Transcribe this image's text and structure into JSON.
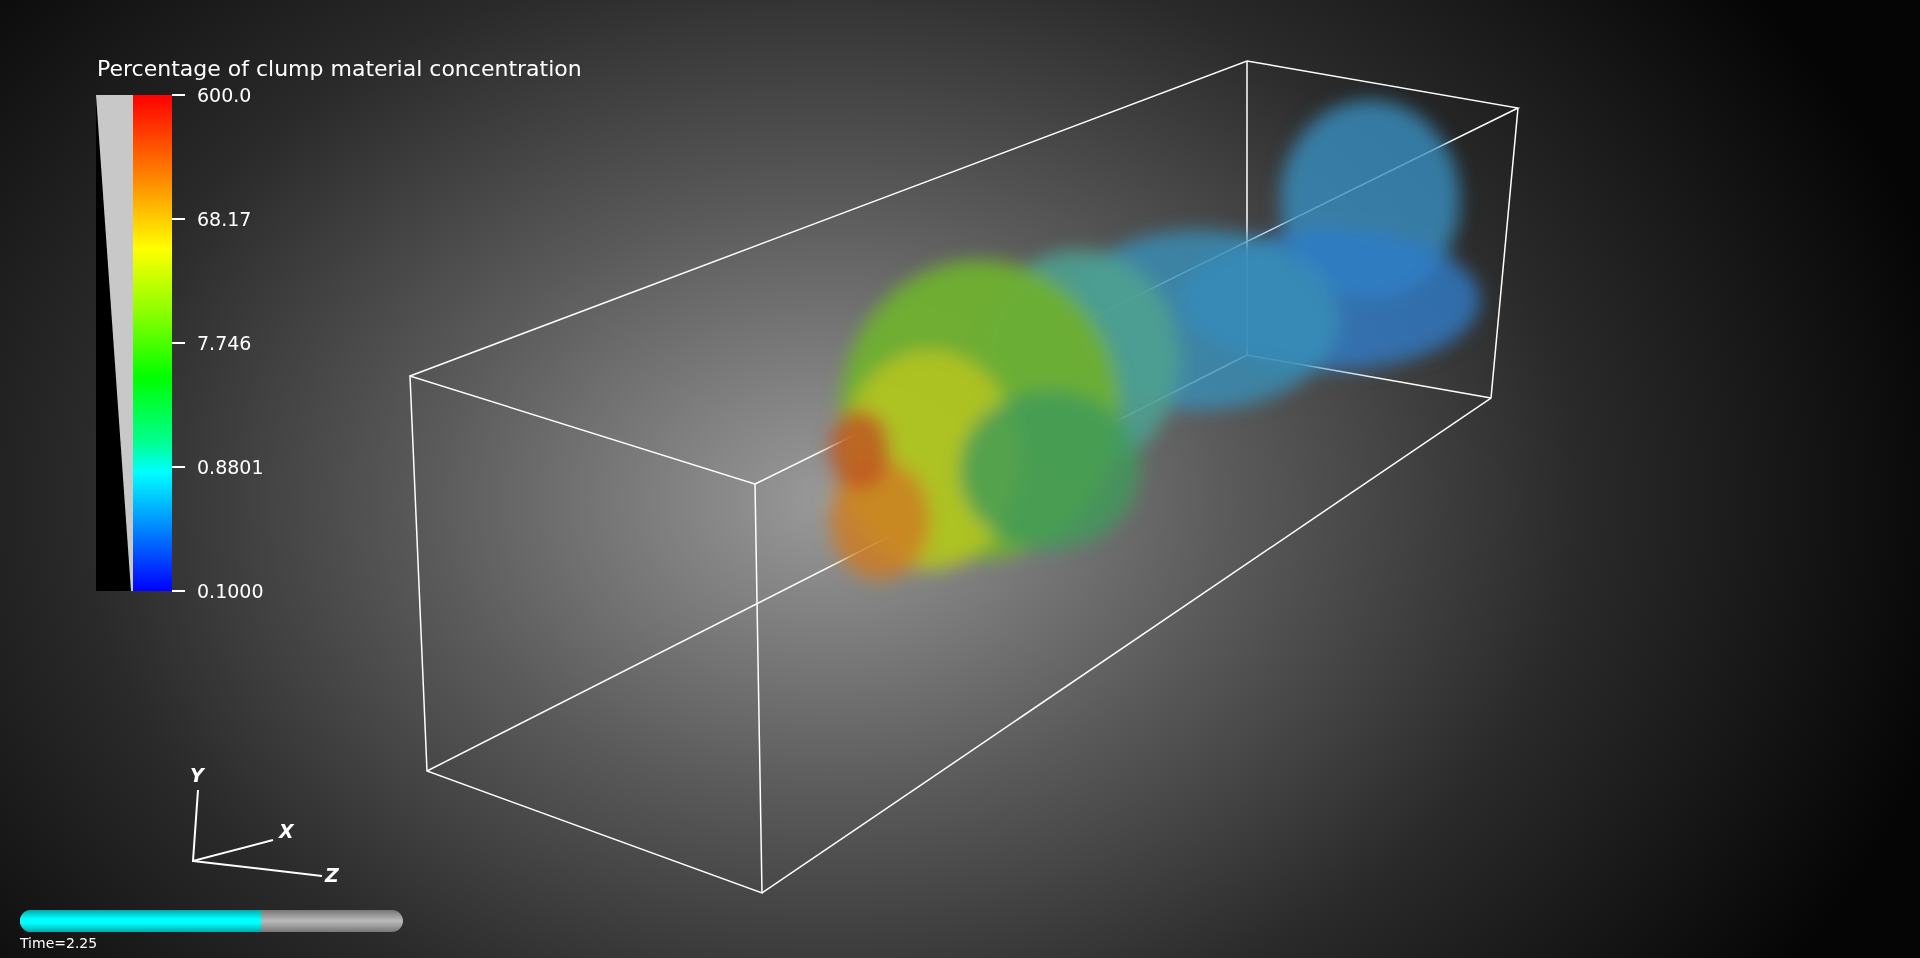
{
  "legend": {
    "title": "Percentage of clump material concentration",
    "ticks": [
      "600.0",
      "68.17",
      "7.746",
      "0.8801",
      "0.1000"
    ]
  },
  "orientation_axes": {
    "labels": [
      "Y",
      "X",
      "Z"
    ]
  },
  "time": {
    "level": 0.63,
    "label": "Time=2.25"
  }
}
